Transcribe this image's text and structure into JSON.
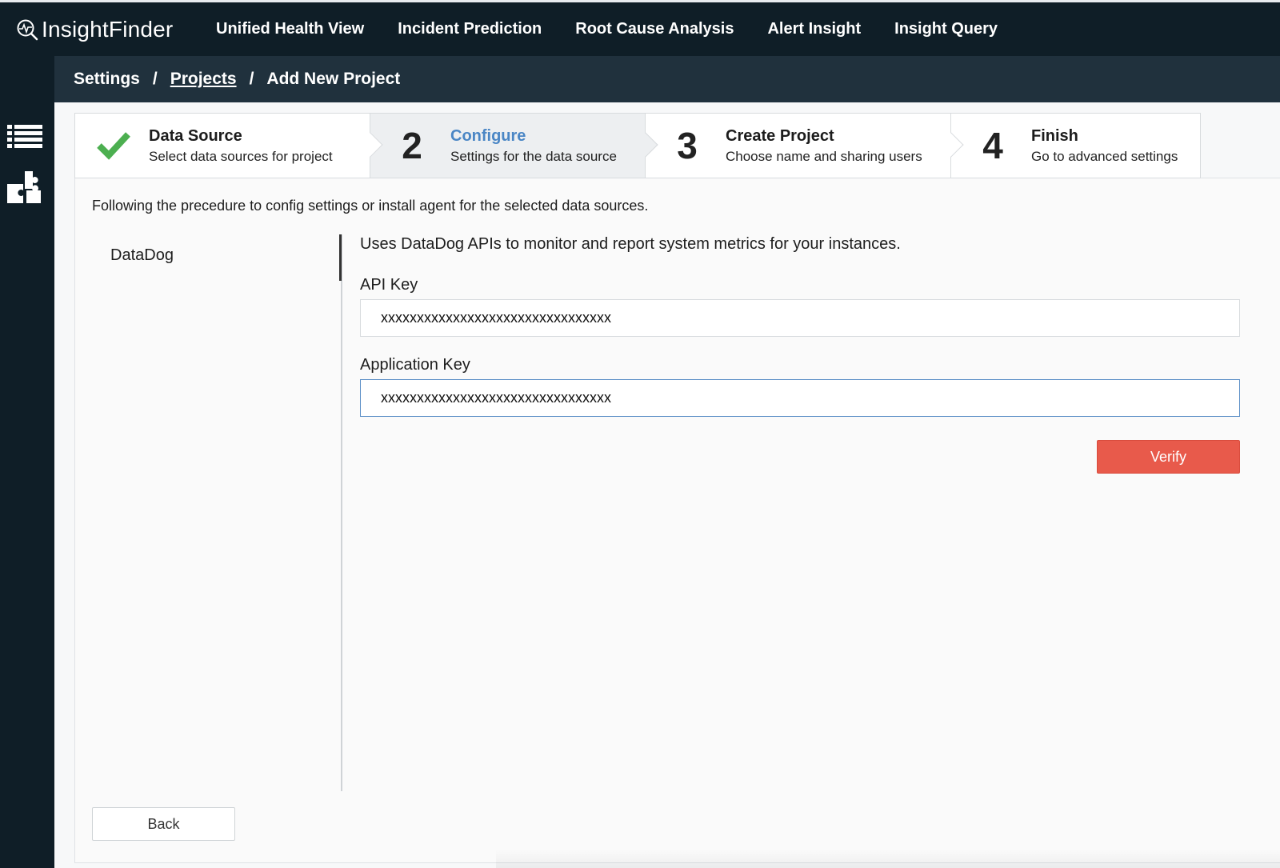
{
  "app": {
    "brand": "InsightFinder"
  },
  "nav": {
    "items": [
      {
        "label": "Unified Health View"
      },
      {
        "label": "Incident Prediction"
      },
      {
        "label": "Root Cause Analysis"
      },
      {
        "label": "Alert Insight"
      },
      {
        "label": "Insight Query"
      }
    ]
  },
  "sidebar": {
    "icons": [
      "list-icon",
      "puzzle-icon"
    ]
  },
  "breadcrumb": {
    "items": [
      "Settings",
      "Projects",
      "Add New Project"
    ],
    "separator": "/"
  },
  "stepper": {
    "steps": [
      {
        "number": "",
        "title": "Data Source",
        "subtitle": "Select data sources for project",
        "status": "completed"
      },
      {
        "number": "2",
        "title": "Configure",
        "subtitle": "Settings for the data source",
        "status": "active"
      },
      {
        "number": "3",
        "title": "Create Project",
        "subtitle": "Choose name and sharing users",
        "status": "pending"
      },
      {
        "number": "4",
        "title": "Finish",
        "subtitle": "Go to advanced settings",
        "status": "pending"
      }
    ]
  },
  "main": {
    "intro": "Following the precedure to config settings or install agent for the selected data sources.",
    "sources": [
      "DataDog"
    ],
    "description": "Uses DataDog APIs to monitor and report system metrics for your instances.",
    "api_key": {
      "label": "API Key",
      "value": "xxxxxxxxxxxxxxxxxxxxxxxxxxxxxxxx"
    },
    "app_key": {
      "label": "Application Key",
      "value": "xxxxxxxxxxxxxxxxxxxxxxxxxxxxxxxx"
    },
    "verify_label": "Verify",
    "back_label": "Back"
  },
  "colors": {
    "nav_bg": "#0f1e27",
    "breadcrumb_bg": "#20313d",
    "active_step": "#4a86c5",
    "check": "#4caf50",
    "verify_btn": "#e85a4b"
  }
}
